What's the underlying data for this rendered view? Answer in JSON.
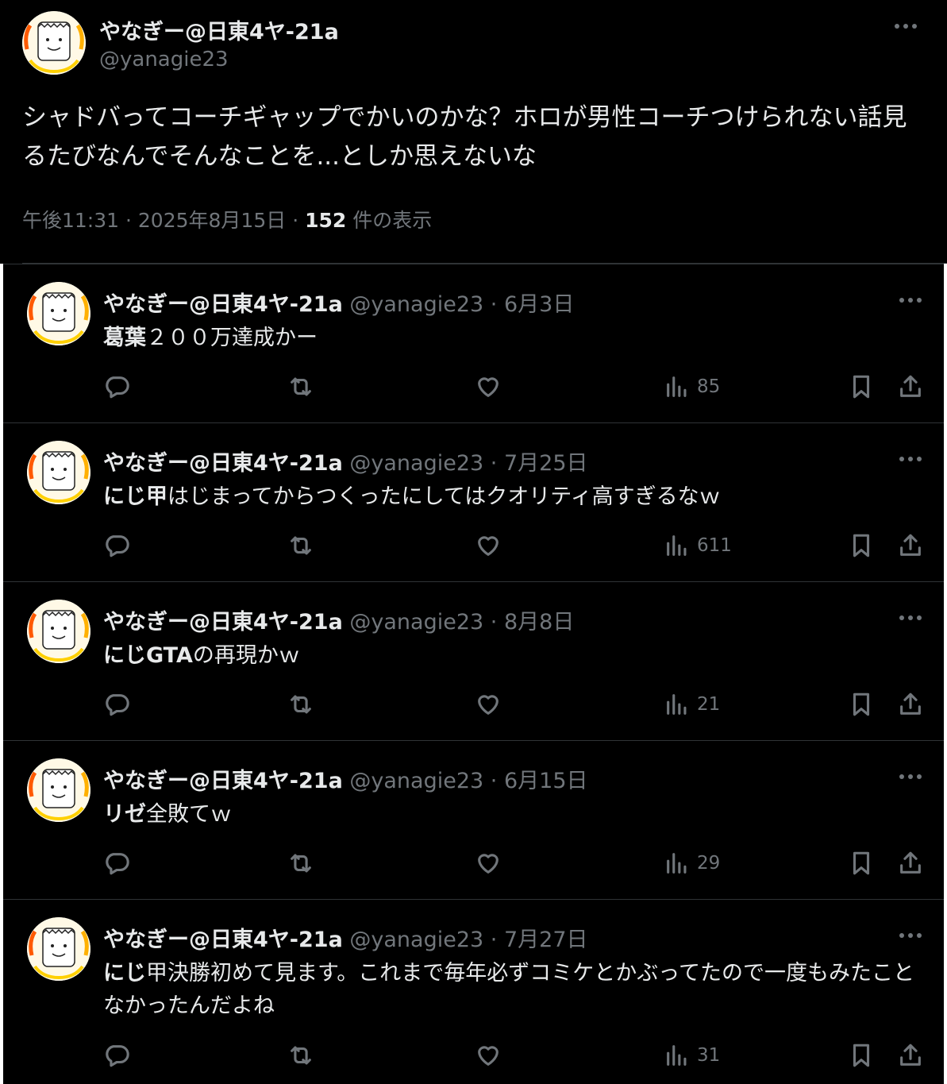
{
  "main_tweet": {
    "author_name": "やなぎー@日東4ヤ-21a",
    "author_handle": "@yanagie23",
    "text": "シャドバってコーチギャップでかいのかな？ホロが男性コーチつけられない話見るたびなんでそんなことを...としか思えないな",
    "time": "午後11:31",
    "date": "2025年8月15日",
    "views_count": "152",
    "views_label": "件の表示"
  },
  "replies": [
    {
      "name": "やなぎー@日東4ヤ-21a",
      "handle": "@yanagie23",
      "date": "6月3日",
      "bold": "葛葉",
      "text": "２００万達成かー",
      "views": "85"
    },
    {
      "name": "やなぎー@日東4ヤ-21a",
      "handle": "@yanagie23",
      "date": "7月25日",
      "bold": "にじ甲",
      "text": "はじまってからつくったにしてはクオリティ高すぎるなｗ",
      "views": "611"
    },
    {
      "name": "やなぎー@日東4ヤ-21a",
      "handle": "@yanagie23",
      "date": "8月8日",
      "bold": "にじGTA",
      "text": "の再現かｗ",
      "views": "21"
    },
    {
      "name": "やなぎー@日東4ヤ-21a",
      "handle": "@yanagie23",
      "date": "6月15日",
      "bold": "リゼ",
      "text": "全敗てｗ",
      "views": "29"
    },
    {
      "name": "やなぎー@日東4ヤ-21a",
      "handle": "@yanagie23",
      "date": "7月27日",
      "bold": "にじ",
      "text": "甲決勝初めて見ます。これまで毎年必ずコミケとかぶってたので一度もみたことなかったんだよね",
      "views": "31"
    }
  ],
  "separators": {
    "dot": "·"
  },
  "icons": [
    "more-icon",
    "reply-icon",
    "retweet-icon",
    "like-icon",
    "views-icon",
    "bookmark-icon",
    "share-icon"
  ]
}
